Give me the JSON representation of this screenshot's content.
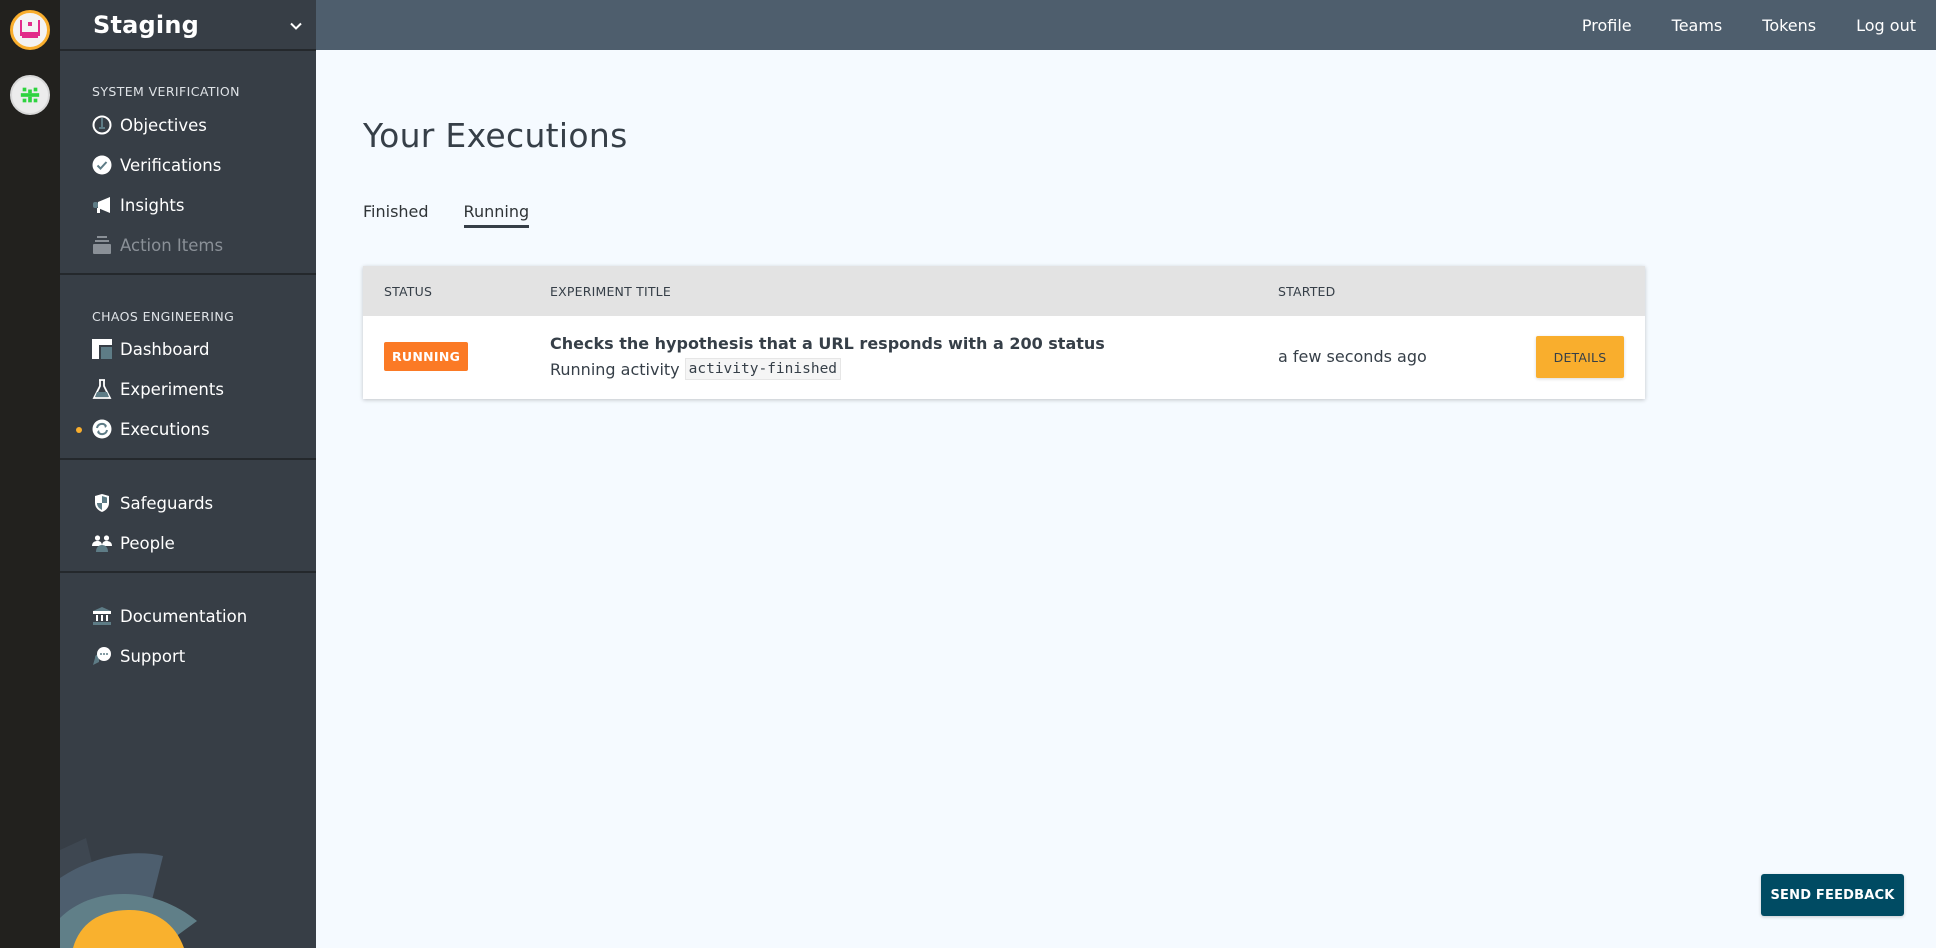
{
  "orgs": [
    {
      "name": "org-avatar-1",
      "selected": true
    },
    {
      "name": "org-avatar-2",
      "selected": false
    }
  ],
  "workspace": {
    "title": "Staging"
  },
  "sidebar": {
    "sections": [
      {
        "label": "SYSTEM VERIFICATION",
        "items": [
          {
            "label": "Objectives",
            "icon": "gauge-icon",
            "disabled": false
          },
          {
            "label": "Verifications",
            "icon": "check-circle-icon",
            "disabled": false
          },
          {
            "label": "Insights",
            "icon": "megaphone-icon",
            "disabled": false
          },
          {
            "label": "Action Items",
            "icon": "inbox-stack-icon",
            "disabled": true
          }
        ]
      },
      {
        "label": "CHAOS ENGINEERING",
        "items": [
          {
            "label": "Dashboard",
            "icon": "dashboard-icon",
            "disabled": false
          },
          {
            "label": "Experiments",
            "icon": "flask-icon",
            "disabled": false
          },
          {
            "label": "Executions",
            "icon": "refresh-circle-icon",
            "disabled": false,
            "active": true
          }
        ]
      },
      {
        "label": "",
        "items": [
          {
            "label": "Safeguards",
            "icon": "shield-icon",
            "disabled": false
          },
          {
            "label": "People",
            "icon": "people-icon",
            "disabled": false
          }
        ]
      },
      {
        "label": "",
        "items": [
          {
            "label": "Documentation",
            "icon": "institution-icon",
            "disabled": false
          },
          {
            "label": "Support",
            "icon": "chat-bubble-icon",
            "disabled": false
          }
        ]
      }
    ]
  },
  "topnav": {
    "links": [
      "Profile",
      "Teams",
      "Tokens",
      "Log out"
    ]
  },
  "main": {
    "title": "Your Executions",
    "tabs": [
      {
        "label": "Finished",
        "active": false
      },
      {
        "label": "Running",
        "active": true
      }
    ],
    "table": {
      "columns": [
        "STATUS",
        "EXPERIMENT TITLE",
        "STARTED"
      ],
      "rows": [
        {
          "status": "RUNNING",
          "title": "Checks the hypothesis that a URL responds with a 200 status",
          "subtitle_prefix": "Running activity",
          "activity": "activity-finished",
          "started": "a few seconds ago",
          "action": "DETAILS"
        }
      ]
    }
  },
  "feedback": {
    "label": "SEND FEEDBACK"
  },
  "colors": {
    "accent": "#f9ae2d",
    "running_badge": "#fb7a25",
    "topbar": "#4e5e6d",
    "sidebar": "#373e46",
    "feedback_button": "#004b63"
  }
}
